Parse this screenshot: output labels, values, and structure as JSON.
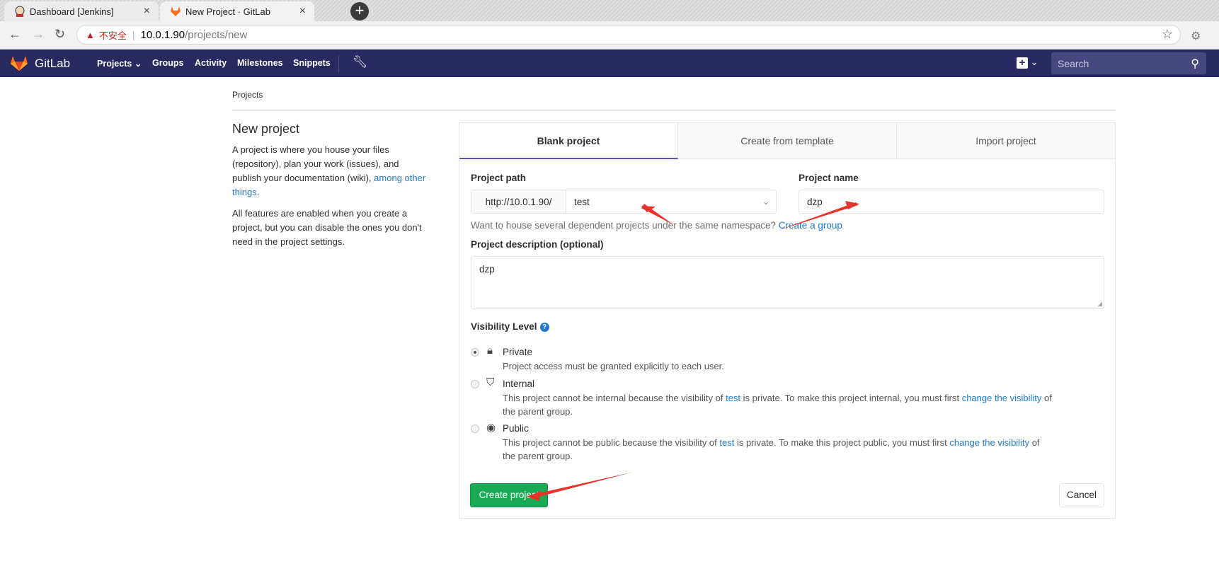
{
  "browser": {
    "tabs": [
      {
        "title": "Dashboard [Jenkins]",
        "icon": "jenkins-icon"
      },
      {
        "title": "New Project · GitLab",
        "icon": "gitlab-icon"
      }
    ],
    "insecure_label": "不安全",
    "url_host": "10.0.1.90",
    "url_path": "/projects/new"
  },
  "header": {
    "brand": "GitLab",
    "nav": [
      "Projects",
      "Groups",
      "Activity",
      "Milestones",
      "Snippets"
    ],
    "search_placeholder": "Search"
  },
  "breadcrumb": "Projects",
  "intro": {
    "title": "New project",
    "p1_text": "A project is where you house your files (repository), plan your work (issues), and publish your documentation (wiki),",
    "p1_link": "among other things",
    "p2": "All features are enabled when you create a project, but you can disable the ones you don't need in the project settings."
  },
  "tabs": [
    "Blank project",
    "Create from template",
    "Import project"
  ],
  "form": {
    "project_path_label": "Project path",
    "path_prefix": "http://10.0.1.90/",
    "namespace_value": "test",
    "project_name_label": "Project name",
    "project_name_value": "dzp",
    "hint_text": "Want to house several dependent projects under the same namespace?",
    "hint_link": "Create a group",
    "description_label": "Project description (optional)",
    "description_value": "dzp",
    "visibility_label": "Visibility Level",
    "visibility": [
      {
        "name": "Private",
        "icon": "lock-icon",
        "selected": true,
        "desc": "Project access must be granted explicitly to each user."
      },
      {
        "name": "Internal",
        "icon": "shield-icon",
        "selected": false,
        "desc_a": "This project cannot be internal because the visibility of",
        "desc_link1": "test",
        "desc_b": "is private. To make this project internal, you must first",
        "desc_link2": "change the visibility",
        "desc_c": "of the parent group."
      },
      {
        "name": "Public",
        "icon": "globe-icon",
        "selected": false,
        "desc_a": "This project cannot be public because the visibility of",
        "desc_link1": "test",
        "desc_b": "is private. To make this project public, you must first",
        "desc_link2": "change the visibility",
        "desc_c": "of the parent group."
      }
    ],
    "create_label": "Create project",
    "cancel_label": "Cancel"
  },
  "colors": {
    "header_bg": "#292961",
    "accent": "#1aaa55",
    "link": "#1f78d1",
    "annotation": "#e8322c"
  }
}
